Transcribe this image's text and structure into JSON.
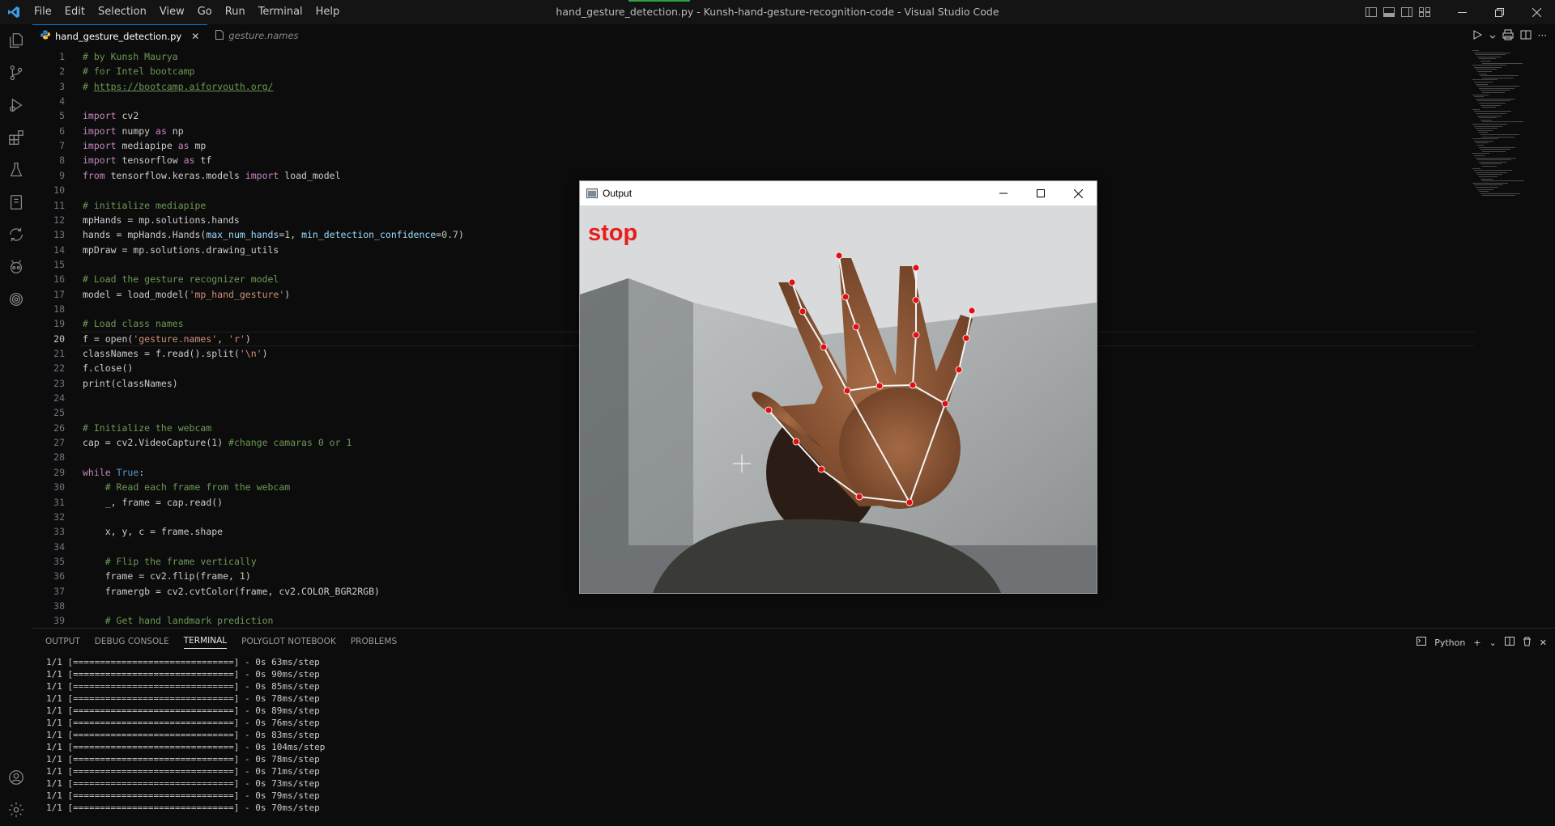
{
  "window": {
    "title": "hand_gesture_detection.py - Kunsh-hand-gesture-recognition-code - Visual Studio Code",
    "menu": [
      "File",
      "Edit",
      "Selection",
      "View",
      "Go",
      "Run",
      "Terminal",
      "Help"
    ]
  },
  "activity_bar": {
    "items": [
      "explorer-icon",
      "source-control-icon",
      "run-debug-icon",
      "extensions-icon",
      "testing-icon",
      "notebook-icon",
      "remote-icon",
      "copilot-icon",
      "fingerprint-icon"
    ],
    "bottom": [
      "account-icon",
      "settings-gear-icon"
    ]
  },
  "tabs": [
    {
      "label": "hand_gesture_detection.py",
      "active": true,
      "icon": "python-file-icon"
    },
    {
      "label": "gesture.names",
      "active": false,
      "icon": "file-icon"
    }
  ],
  "editor": {
    "current_line": 20,
    "lines": [
      [
        {
          "t": "# by Kunsh Maurya",
          "c": "c"
        }
      ],
      [
        {
          "t": "# for Intel bootcamp",
          "c": "c"
        }
      ],
      [
        {
          "t": "# ",
          "c": "c"
        },
        {
          "t": "https://bootcamp.aiforyouth.org/",
          "c": "c u"
        }
      ],
      [],
      [
        {
          "t": "import",
          "c": "k"
        },
        {
          "t": " cv2"
        }
      ],
      [
        {
          "t": "import",
          "c": "k"
        },
        {
          "t": " numpy "
        },
        {
          "t": "as",
          "c": "k"
        },
        {
          "t": " np"
        }
      ],
      [
        {
          "t": "import",
          "c": "k"
        },
        {
          "t": " mediapipe "
        },
        {
          "t": "as",
          "c": "k"
        },
        {
          "t": " mp"
        }
      ],
      [
        {
          "t": "import",
          "c": "k"
        },
        {
          "t": " tensorflow "
        },
        {
          "t": "as",
          "c": "k"
        },
        {
          "t": " tf"
        }
      ],
      [
        {
          "t": "from",
          "c": "k"
        },
        {
          "t": " tensorflow.keras.models "
        },
        {
          "t": "import",
          "c": "k"
        },
        {
          "t": " load_model"
        }
      ],
      [],
      [
        {
          "t": "# initialize mediapipe",
          "c": "c"
        }
      ],
      [
        {
          "t": "mpHands = mp.solutions.hands"
        }
      ],
      [
        {
          "t": "hands = mpHands.Hands("
        },
        {
          "t": "max_num_hands",
          "c": "p"
        },
        {
          "t": "="
        },
        {
          "t": "1",
          "c": "n"
        },
        {
          "t": ", "
        },
        {
          "t": "min_detection_confidence",
          "c": "p"
        },
        {
          "t": "="
        },
        {
          "t": "0.7",
          "c": "n"
        },
        {
          "t": ")"
        }
      ],
      [
        {
          "t": "mpDraw = mp.solutions.drawing_utils"
        }
      ],
      [],
      [
        {
          "t": "# Load the gesture recognizer model",
          "c": "c"
        }
      ],
      [
        {
          "t": "model = load_model("
        },
        {
          "t": "'mp_hand_gesture'",
          "c": "s"
        },
        {
          "t": ")"
        }
      ],
      [],
      [
        {
          "t": "# Load class names",
          "c": "c"
        }
      ],
      [
        {
          "t": "f = open("
        },
        {
          "t": "'gesture.names'",
          "c": "s"
        },
        {
          "t": ", "
        },
        {
          "t": "'r'",
          "c": "s"
        },
        {
          "t": ")"
        }
      ],
      [
        {
          "t": "classNames = f.read().split("
        },
        {
          "t": "'\\n'",
          "c": "s"
        },
        {
          "t": ")"
        }
      ],
      [
        {
          "t": "f.close()"
        }
      ],
      [
        {
          "t": "print(classNames)"
        }
      ],
      [],
      [],
      [
        {
          "t": "# Initialize the webcam",
          "c": "c"
        }
      ],
      [
        {
          "t": "cap = cv2.VideoCapture("
        },
        {
          "t": "1",
          "c": "n"
        },
        {
          "t": ") "
        },
        {
          "t": "#change camaras 0 or 1",
          "c": "c"
        }
      ],
      [],
      [
        {
          "t": "while",
          "c": "k"
        },
        {
          "t": " "
        },
        {
          "t": "True",
          "c": "b"
        },
        {
          "t": ":"
        }
      ],
      [
        {
          "t": "    "
        },
        {
          "t": "# Read each frame from the webcam",
          "c": "c"
        }
      ],
      [
        {
          "t": "    _, frame = cap.read()"
        }
      ],
      [],
      [
        {
          "t": "    x, y, c = frame.shape"
        }
      ],
      [],
      [
        {
          "t": "    "
        },
        {
          "t": "# Flip the frame vertically",
          "c": "c"
        }
      ],
      [
        {
          "t": "    frame = cv2.flip(frame, "
        },
        {
          "t": "1",
          "c": "n"
        },
        {
          "t": ")"
        }
      ],
      [
        {
          "t": "    framergb = cv2.cvtColor(frame, cv2.COLOR_BGR2RGB)"
        }
      ],
      [],
      [
        {
          "t": "    "
        },
        {
          "t": "# Get hand landmark prediction",
          "c": "c"
        }
      ]
    ]
  },
  "panel": {
    "tabs": [
      "OUTPUT",
      "DEBUG CONSOLE",
      "TERMINAL",
      "POLYGLOT NOTEBOOK",
      "PROBLEMS"
    ],
    "active_tab": "TERMINAL",
    "shell": "Python",
    "terminal_lines": [
      "1/1 [==============================] - 0s 63ms/step",
      "1/1 [==============================] - 0s 90ms/step",
      "1/1 [==============================] - 0s 85ms/step",
      "1/1 [==============================] - 0s 78ms/step",
      "1/1 [==============================] - 0s 89ms/step",
      "1/1 [==============================] - 0s 76ms/step",
      "1/1 [==============================] - 0s 83ms/step",
      "1/1 [==============================] - 0s 104ms/step",
      "1/1 [==============================] - 0s 78ms/step",
      "1/1 [==============================] - 0s 71ms/step",
      "1/1 [==============================] - 0s 73ms/step",
      "1/1 [==============================] - 0s 79ms/step",
      "1/1 [==============================] - 0s 70ms/step"
    ]
  },
  "output_window": {
    "title": "Output",
    "gesture_label": "stop",
    "label_color": "#e81d1d",
    "landmark_color": "#e01010",
    "connection_color": "#f5f5f5"
  }
}
